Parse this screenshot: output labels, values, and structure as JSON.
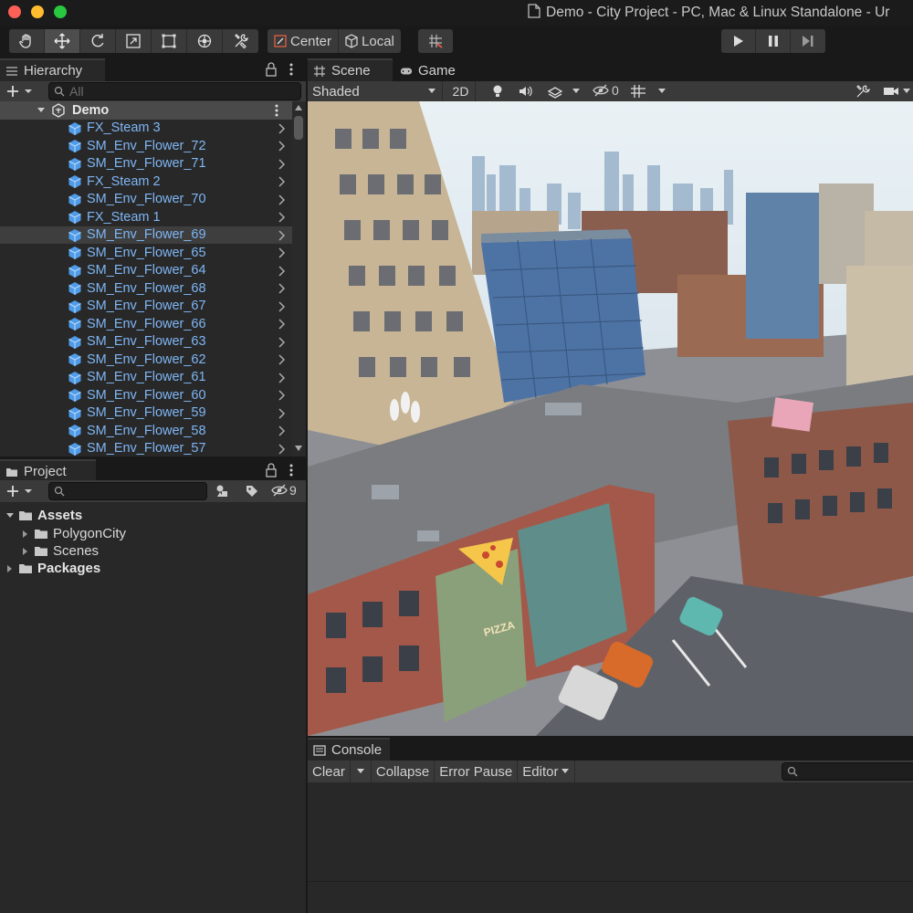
{
  "window": {
    "title": "Demo - City Project - PC, Mac & Linux Standalone - Ur"
  },
  "toolbar": {
    "tools": [
      "hand-tool",
      "move-tool",
      "rotate-tool",
      "scale-tool",
      "rect-tool",
      "transform-tool",
      "custom-tool"
    ],
    "active_tool": "move-tool",
    "pivot_label": "Center",
    "space_label": "Local"
  },
  "hierarchy": {
    "tab_label": "Hierarchy",
    "search_placeholder": "All",
    "root": "Demo",
    "selected": "SM_Env_Flower_69",
    "items": [
      "FX_Steam 3",
      "SM_Env_Flower_72",
      "SM_Env_Flower_71",
      "FX_Steam 2",
      "SM_Env_Flower_70",
      "FX_Steam 1",
      "SM_Env_Flower_69",
      "SM_Env_Flower_65",
      "SM_Env_Flower_64",
      "SM_Env_Flower_68",
      "SM_Env_Flower_67",
      "SM_Env_Flower_66",
      "SM_Env_Flower_63",
      "SM_Env_Flower_62",
      "SM_Env_Flower_61",
      "SM_Env_Flower_60",
      "SM_Env_Flower_59",
      "SM_Env_Flower_58",
      "SM_Env_Flower_57"
    ]
  },
  "project": {
    "tab_label": "Project",
    "search_value": "",
    "hidden_count": "9",
    "tree": {
      "assets": "Assets",
      "polygon_city": "PolygonCity",
      "scenes": "Scenes",
      "packages": "Packages"
    }
  },
  "scene": {
    "tabs": {
      "scene": "Scene",
      "game": "Game"
    },
    "shading_mode": "Shaded",
    "mode_2d": "2D",
    "hidden_count": "0",
    "sign_text": "PIZZA"
  },
  "console": {
    "tab_label": "Console",
    "clear": "Clear",
    "collapse": "Collapse",
    "error_pause": "Error Pause",
    "editor": "Editor"
  },
  "colors": {
    "hierarchy_item": "#7fb6f5",
    "panel_bg": "#282828",
    "header_bg": "#3a3a3a",
    "sky": "#dce8ee"
  }
}
